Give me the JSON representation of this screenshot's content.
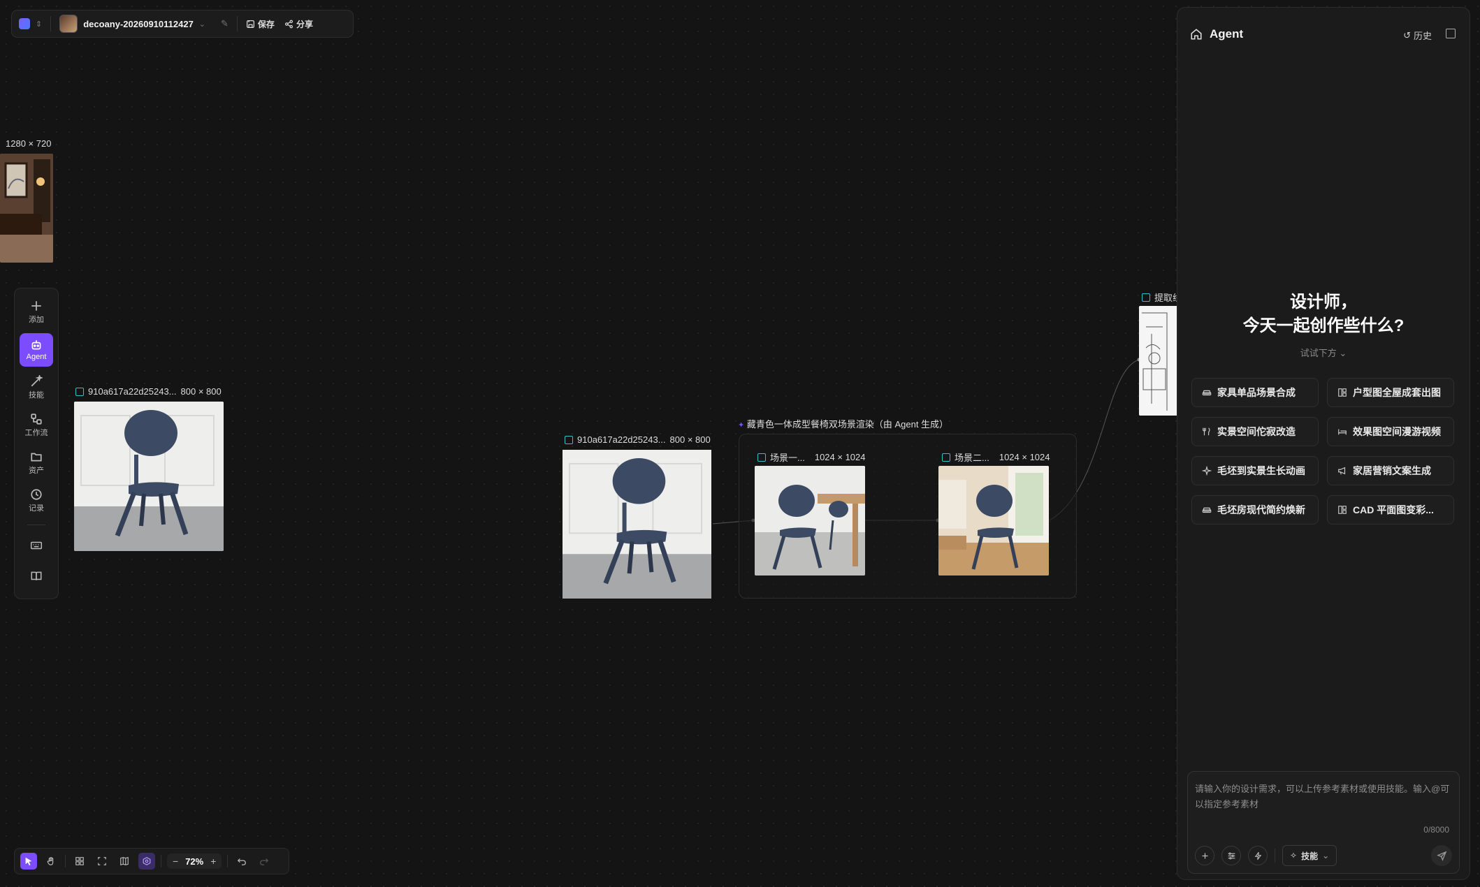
{
  "topbar": {
    "project_name": "decoany-20260910112427",
    "save_label": "保存",
    "share_label": "分享"
  },
  "left_toolbar": {
    "items": [
      {
        "label": "添加",
        "icon": "plus-icon"
      },
      {
        "label": "Agent",
        "icon": "robot-icon"
      },
      {
        "label": "技能",
        "icon": "magic-wand-icon"
      },
      {
        "label": "工作流",
        "icon": "workflow-icon"
      },
      {
        "label": "资产",
        "icon": "folder-icon"
      },
      {
        "label": "记录",
        "icon": "clock-icon"
      }
    ]
  },
  "bottom_toolbar": {
    "zoom": "72%"
  },
  "canvas": {
    "node_top_left": {
      "size": "1280 × 720"
    },
    "node_chair_left": {
      "name": "910a617a22d25243...",
      "size": "800 × 800"
    },
    "node_chair_mid": {
      "name": "910a617a22d25243...",
      "size": "800 × 800"
    },
    "group": {
      "title": "藏青色一体成型餐椅双场景渲染（由 Agent 生成）",
      "scene1": {
        "name": "场景一...",
        "size": "1024 × 1024"
      },
      "scene2": {
        "name": "场景二...",
        "size": "1024 × 1024"
      }
    },
    "node_right": {
      "name": "提取线"
    }
  },
  "agent": {
    "title": "Agent",
    "history_label": "历史",
    "hero_line1": "设计师，",
    "hero_line2": "今天一起创作些什么?",
    "try_label": "试试下方",
    "suggestions": [
      {
        "label": "家具单品场景合成",
        "icon": "sofa-icon"
      },
      {
        "label": "户型图全屋成套出图",
        "icon": "layout-icon"
      },
      {
        "label": "实景空间佗寂改造",
        "icon": "dining-icon"
      },
      {
        "label": "效果图空间漫游视频",
        "icon": "bed-icon"
      },
      {
        "label": "毛坯到实景生长动画",
        "icon": "sparkle-icon"
      },
      {
        "label": "家居营销文案生成",
        "icon": "megaphone-icon"
      },
      {
        "label": "毛坯房现代简约焕新",
        "icon": "sofa-icon"
      },
      {
        "label": "CAD 平面图变彩...",
        "icon": "layout-icon"
      }
    ],
    "input_placeholder": "请输入你的设计需求，可以上传参考素材或使用技能。输入@可以指定参考素材",
    "char_counter": "0/8000",
    "skill_button": "技能"
  },
  "colors": {
    "accent": "#7c4dff",
    "node_icon": "#36c0c8",
    "background": "#141414"
  }
}
